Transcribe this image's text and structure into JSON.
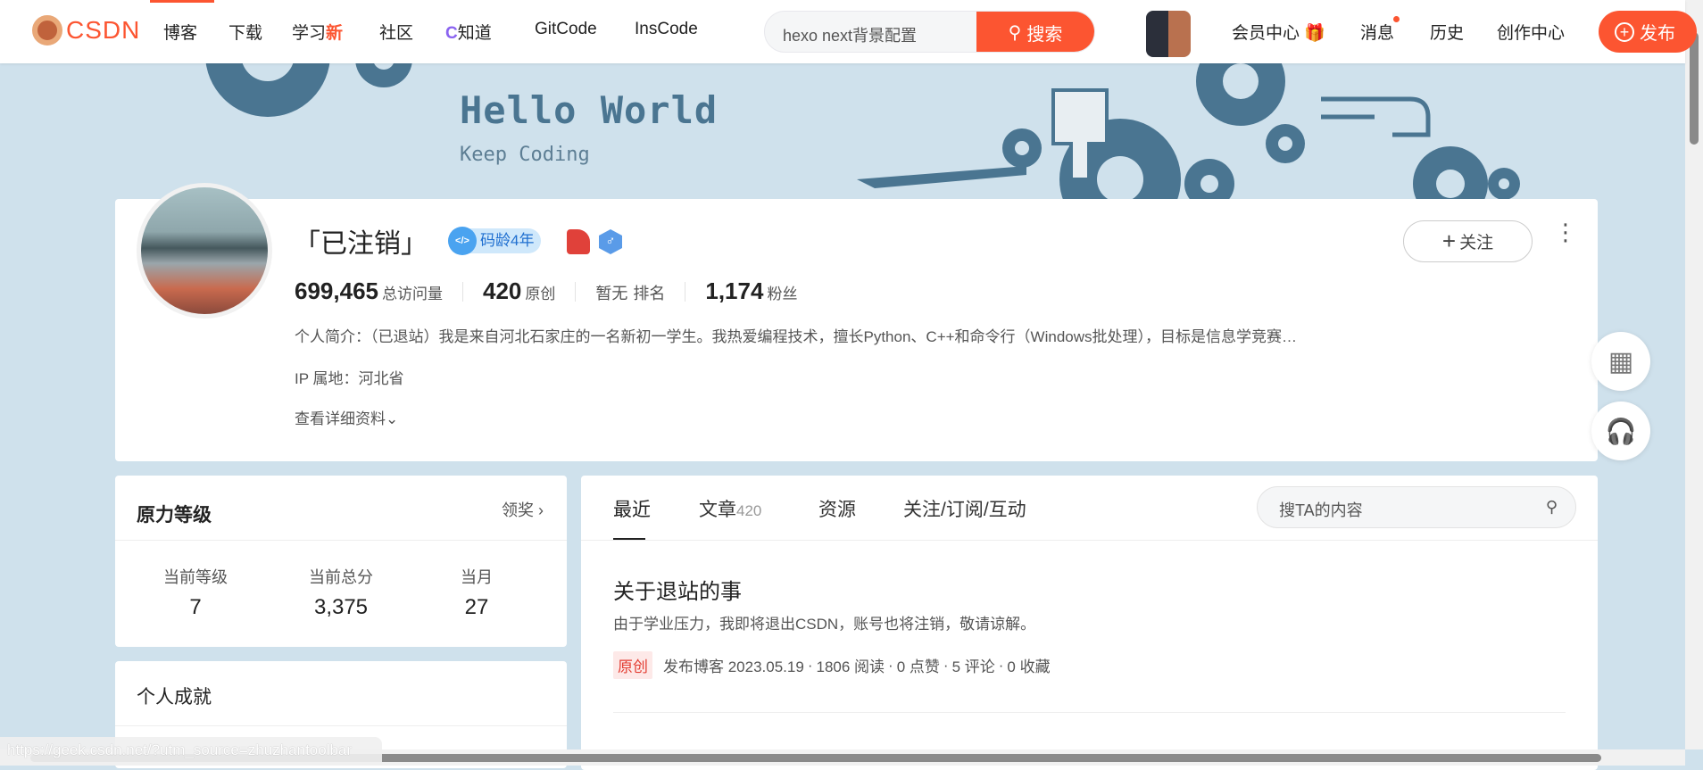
{
  "nav": {
    "logo": "CSDN",
    "items": [
      {
        "label": "博客"
      },
      {
        "label": "下载"
      },
      {
        "label": "学习",
        "badge": "新"
      },
      {
        "label": "社区"
      },
      {
        "label": "知道"
      },
      {
        "label": "GitCode"
      },
      {
        "label": "InsCode"
      }
    ],
    "search_value": "hexo next背景配置",
    "search_button": "搜索",
    "right": [
      "会员中心",
      "消息",
      "历史",
      "创作中心"
    ],
    "publish": "发布",
    "accent": "#fc5531"
  },
  "banner": {
    "title": "Hello World",
    "subtitle": "Keep Coding"
  },
  "profile": {
    "name": "「已注销」",
    "badge": "码龄4年",
    "stats": [
      {
        "value": "699,465",
        "label": "总访问量"
      },
      {
        "value": "420",
        "label": "原创"
      },
      {
        "value": "暂无",
        "label": "排名"
      },
      {
        "value": "1,174",
        "label": "粉丝"
      }
    ],
    "bio": "个人简介：（已退站）我是来自河北石家庄的一名新初一学生。我热爱编程技术，擅长Python、C++和命令行（Windows批处理），目标是信息学竞赛…",
    "ip": "IP 属地：河北省",
    "details": "查看详细资料",
    "follow": "关注"
  },
  "level": {
    "title": "原力等级",
    "link": "领奖",
    "items": [
      {
        "label": "当前等级",
        "value": "7"
      },
      {
        "label": "当前总分",
        "value": "3,375"
      },
      {
        "label": "当月",
        "value": "27"
      }
    ]
  },
  "achievements": {
    "title": "个人成就"
  },
  "main": {
    "tabs": [
      {
        "label": "最近"
      },
      {
        "label": "文章",
        "count": "420"
      },
      {
        "label": "资源"
      },
      {
        "label": "关注/订阅/互动"
      }
    ],
    "search_placeholder": "搜TA的内容",
    "article": {
      "title": "关于退站的事",
      "desc": "由于学业压力，我即将退出CSDN，账号也将注销，敬请谅解。",
      "tag": "原创",
      "date": "发布博客 2023.05.19",
      "reads": "1806 阅读",
      "likes": "0 点赞",
      "comments": "5 评论",
      "favs": "0 收藏"
    }
  },
  "status_url": "https://geek.csdn.net/?utm_source=zhuzhantoolbar"
}
